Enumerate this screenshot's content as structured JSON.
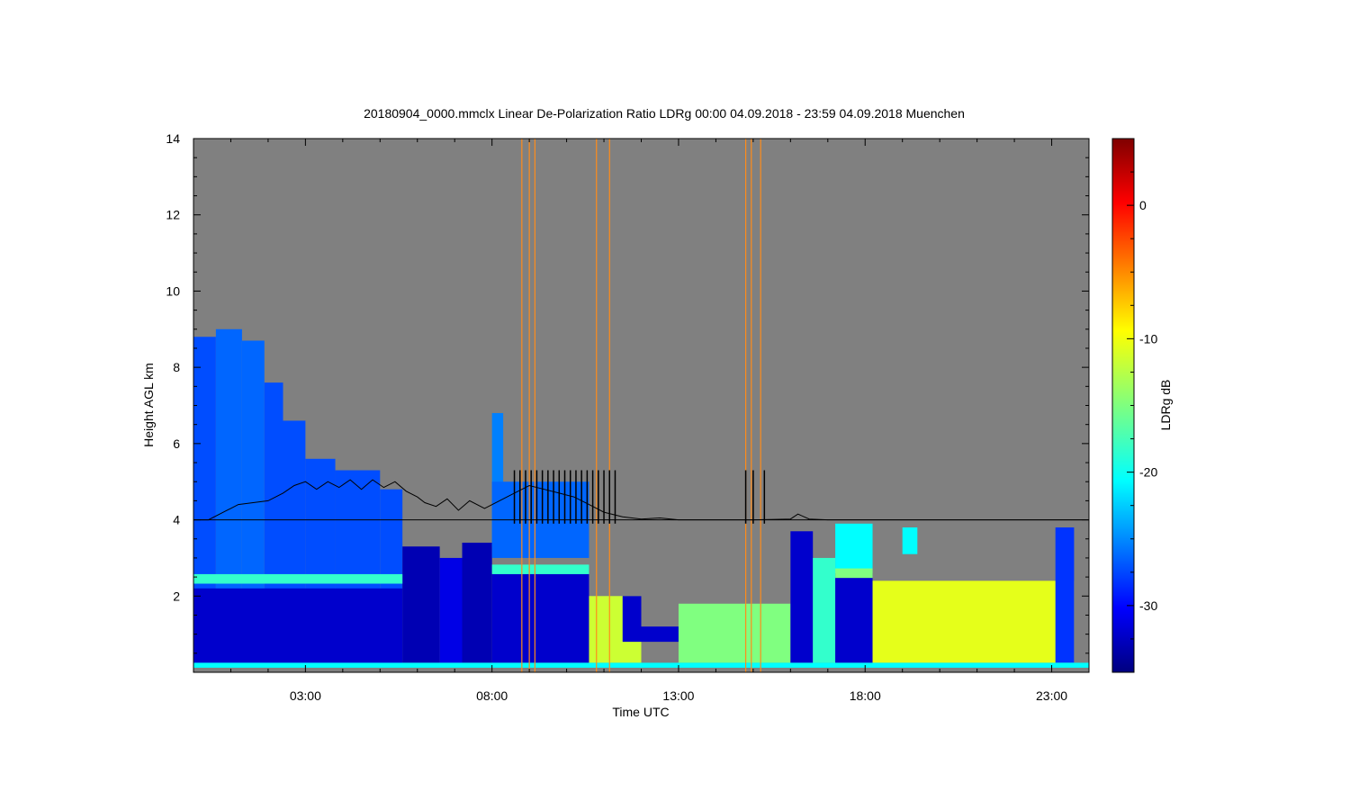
{
  "chart_data": {
    "type": "heatmap",
    "title": "20180904_0000.mmclx Linear De-Polarization Ratio LDRg   00:00 04.09.2018 - 23:59 04.09.2018 Muenchen",
    "xlabel": "Time UTC",
    "ylabel": "Height AGL km",
    "x_tick_labels": [
      "03:00",
      "08:00",
      "13:00",
      "18:00",
      "23:00"
    ],
    "x_tick_values_h": [
      3,
      8,
      13,
      18,
      23
    ],
    "xlim_h": [
      0,
      24
    ],
    "y_tick_labels": [
      "2",
      "4",
      "6",
      "8",
      "10",
      "12",
      "14"
    ],
    "y_tick_values_km": [
      2,
      4,
      6,
      8,
      10,
      12,
      14
    ],
    "ylim_km": [
      0,
      14
    ],
    "colorbar": {
      "label": "LDRg dB",
      "tick_labels": [
        "0",
        "-10",
        "-20",
        "-30"
      ],
      "tick_values": [
        0,
        -10,
        -20,
        -30
      ],
      "range": [
        -35,
        5
      ],
      "colormap": "jet"
    },
    "background_color": "#808080",
    "line_series": {
      "color": "#000000",
      "baseline_km": 4.0,
      "points": [
        [
          0.0,
          4.0
        ],
        [
          0.4,
          4.0
        ],
        [
          0.8,
          4.2
        ],
        [
          1.2,
          4.4
        ],
        [
          1.6,
          4.45
        ],
        [
          2.0,
          4.5
        ],
        [
          2.4,
          4.7
        ],
        [
          2.7,
          4.9
        ],
        [
          3.0,
          5.0
        ],
        [
          3.3,
          4.8
        ],
        [
          3.6,
          5.0
        ],
        [
          3.9,
          4.85
        ],
        [
          4.2,
          5.05
        ],
        [
          4.5,
          4.8
        ],
        [
          4.8,
          5.05
        ],
        [
          5.1,
          4.85
        ],
        [
          5.4,
          5.0
        ],
        [
          5.7,
          4.75
        ],
        [
          6.0,
          4.6
        ],
        [
          6.2,
          4.45
        ],
        [
          6.5,
          4.35
        ],
        [
          6.8,
          4.55
        ],
        [
          7.1,
          4.25
        ],
        [
          7.4,
          4.5
        ],
        [
          7.8,
          4.3
        ],
        [
          8.2,
          4.5
        ],
        [
          8.6,
          4.7
        ],
        [
          9.0,
          4.9
        ],
        [
          9.4,
          4.8
        ],
        [
          9.8,
          4.7
        ],
        [
          10.2,
          4.6
        ],
        [
          10.6,
          4.4
        ],
        [
          11.0,
          4.2
        ],
        [
          11.5,
          4.08
        ],
        [
          12.0,
          4.02
        ],
        [
          12.5,
          4.05
        ],
        [
          13.0,
          4.0
        ],
        [
          14.0,
          4.0
        ],
        [
          15.0,
          4.0
        ],
        [
          16.0,
          4.02
        ],
        [
          16.2,
          4.15
        ],
        [
          16.5,
          4.02
        ],
        [
          17.0,
          4.0
        ],
        [
          18.0,
          4.0
        ],
        [
          20.0,
          4.0
        ],
        [
          22.0,
          4.0
        ],
        [
          24.0,
          4.0
        ]
      ]
    },
    "spike_times_h": [
      8.6,
      8.75,
      8.9,
      9.05,
      9.2,
      9.35,
      9.5,
      9.65,
      9.8,
      9.95,
      10.1,
      10.25,
      10.4,
      10.55,
      10.7,
      10.85,
      11.0,
      11.15,
      11.3,
      14.8,
      15.0,
      15.3
    ],
    "streak_times_h": [
      8.8,
      9.0,
      9.15,
      10.8,
      11.15,
      14.8,
      14.95,
      15.2
    ],
    "regions": [
      {
        "t0": 0.0,
        "t1": 0.6,
        "h0": 0.25,
        "h1": 8.8,
        "ldr_db": -27
      },
      {
        "t0": 0.6,
        "t1": 1.3,
        "h0": 0.25,
        "h1": 9.0,
        "ldr_db": -26
      },
      {
        "t0": 1.3,
        "t1": 1.9,
        "h0": 0.25,
        "h1": 8.7,
        "ldr_db": -26
      },
      {
        "t0": 1.9,
        "t1": 2.4,
        "h0": 0.25,
        "h1": 7.6,
        "ldr_db": -27
      },
      {
        "t0": 2.4,
        "t1": 3.0,
        "h0": 0.25,
        "h1": 6.6,
        "ldr_db": -27
      },
      {
        "t0": 3.0,
        "t1": 3.8,
        "h0": 0.25,
        "h1": 5.6,
        "ldr_db": -27
      },
      {
        "t0": 3.8,
        "t1": 5.0,
        "h0": 0.25,
        "h1": 5.3,
        "ldr_db": -27
      },
      {
        "t0": 5.0,
        "t1": 5.6,
        "h0": 0.25,
        "h1": 4.8,
        "ldr_db": -27
      },
      {
        "t0": 0.0,
        "t1": 5.6,
        "h0": 0.25,
        "h1": 2.2,
        "ldr_db": -32
      },
      {
        "t0": 5.6,
        "t1": 6.6,
        "h0": 0.25,
        "h1": 3.3,
        "ldr_db": -33
      },
      {
        "t0": 6.6,
        "t1": 7.2,
        "h0": 0.25,
        "h1": 3.0,
        "ldr_db": -31
      },
      {
        "t0": 7.2,
        "t1": 8.0,
        "h0": 0.25,
        "h1": 3.4,
        "ldr_db": -33
      },
      {
        "t0": 8.0,
        "t1": 8.3,
        "h0": 3.3,
        "h1": 6.8,
        "ldr_db": -25
      },
      {
        "t0": 8.0,
        "t1": 10.6,
        "h0": 3.0,
        "h1": 5.0,
        "ldr_db": -26
      },
      {
        "t0": 8.0,
        "t1": 10.6,
        "h0": 0.25,
        "h1": 2.6,
        "ldr_db": -32
      },
      {
        "t0": 10.6,
        "t1": 12.0,
        "h0": 0.25,
        "h1": 2.0,
        "ldr_db": -12
      },
      {
        "t0": 11.5,
        "t1": 12.0,
        "h0": 0.8,
        "h1": 2.0,
        "ldr_db": -32
      },
      {
        "t0": 12.0,
        "t1": 13.0,
        "h0": 0.8,
        "h1": 1.2,
        "ldr_db": -32
      },
      {
        "t0": 13.0,
        "t1": 16.0,
        "h0": 0.25,
        "h1": 1.8,
        "ldr_db": -15
      },
      {
        "t0": 16.0,
        "t1": 16.6,
        "h0": 0.25,
        "h1": 3.7,
        "ldr_db": -32
      },
      {
        "t0": 16.6,
        "t1": 17.2,
        "h0": 0.25,
        "h1": 3.0,
        "ldr_db": -18
      },
      {
        "t0": 17.2,
        "t1": 18.2,
        "h0": 0.25,
        "h1": 2.6,
        "ldr_db": -32
      },
      {
        "t0": 17.2,
        "t1": 18.2,
        "h0": 2.6,
        "h1": 3.9,
        "ldr_db": -20
      },
      {
        "t0": 18.2,
        "t1": 23.6,
        "h0": 0.25,
        "h1": 2.4,
        "ldr_db": -11
      },
      {
        "t0": 19.0,
        "t1": 19.4,
        "h0": 3.1,
        "h1": 3.8,
        "ldr_db": -20
      },
      {
        "t0": 23.1,
        "t1": 23.6,
        "h0": 0.25,
        "h1": 3.8,
        "ldr_db": -28
      }
    ],
    "bright_bands": [
      {
        "t0": 0.0,
        "t1": 5.6,
        "h_km": 2.45,
        "thickness_km": 0.25,
        "ldr_db": -18
      },
      {
        "t0": 8.0,
        "t1": 10.6,
        "h_km": 2.7,
        "thickness_km": 0.25,
        "ldr_db": -18
      },
      {
        "t0": 17.2,
        "t1": 18.2,
        "h_km": 2.6,
        "thickness_km": 0.25,
        "ldr_db": -15
      }
    ],
    "surface_layer": {
      "t0": 0.0,
      "t1": 24.0,
      "h_km": 0.25,
      "ldr_db": -20
    }
  }
}
